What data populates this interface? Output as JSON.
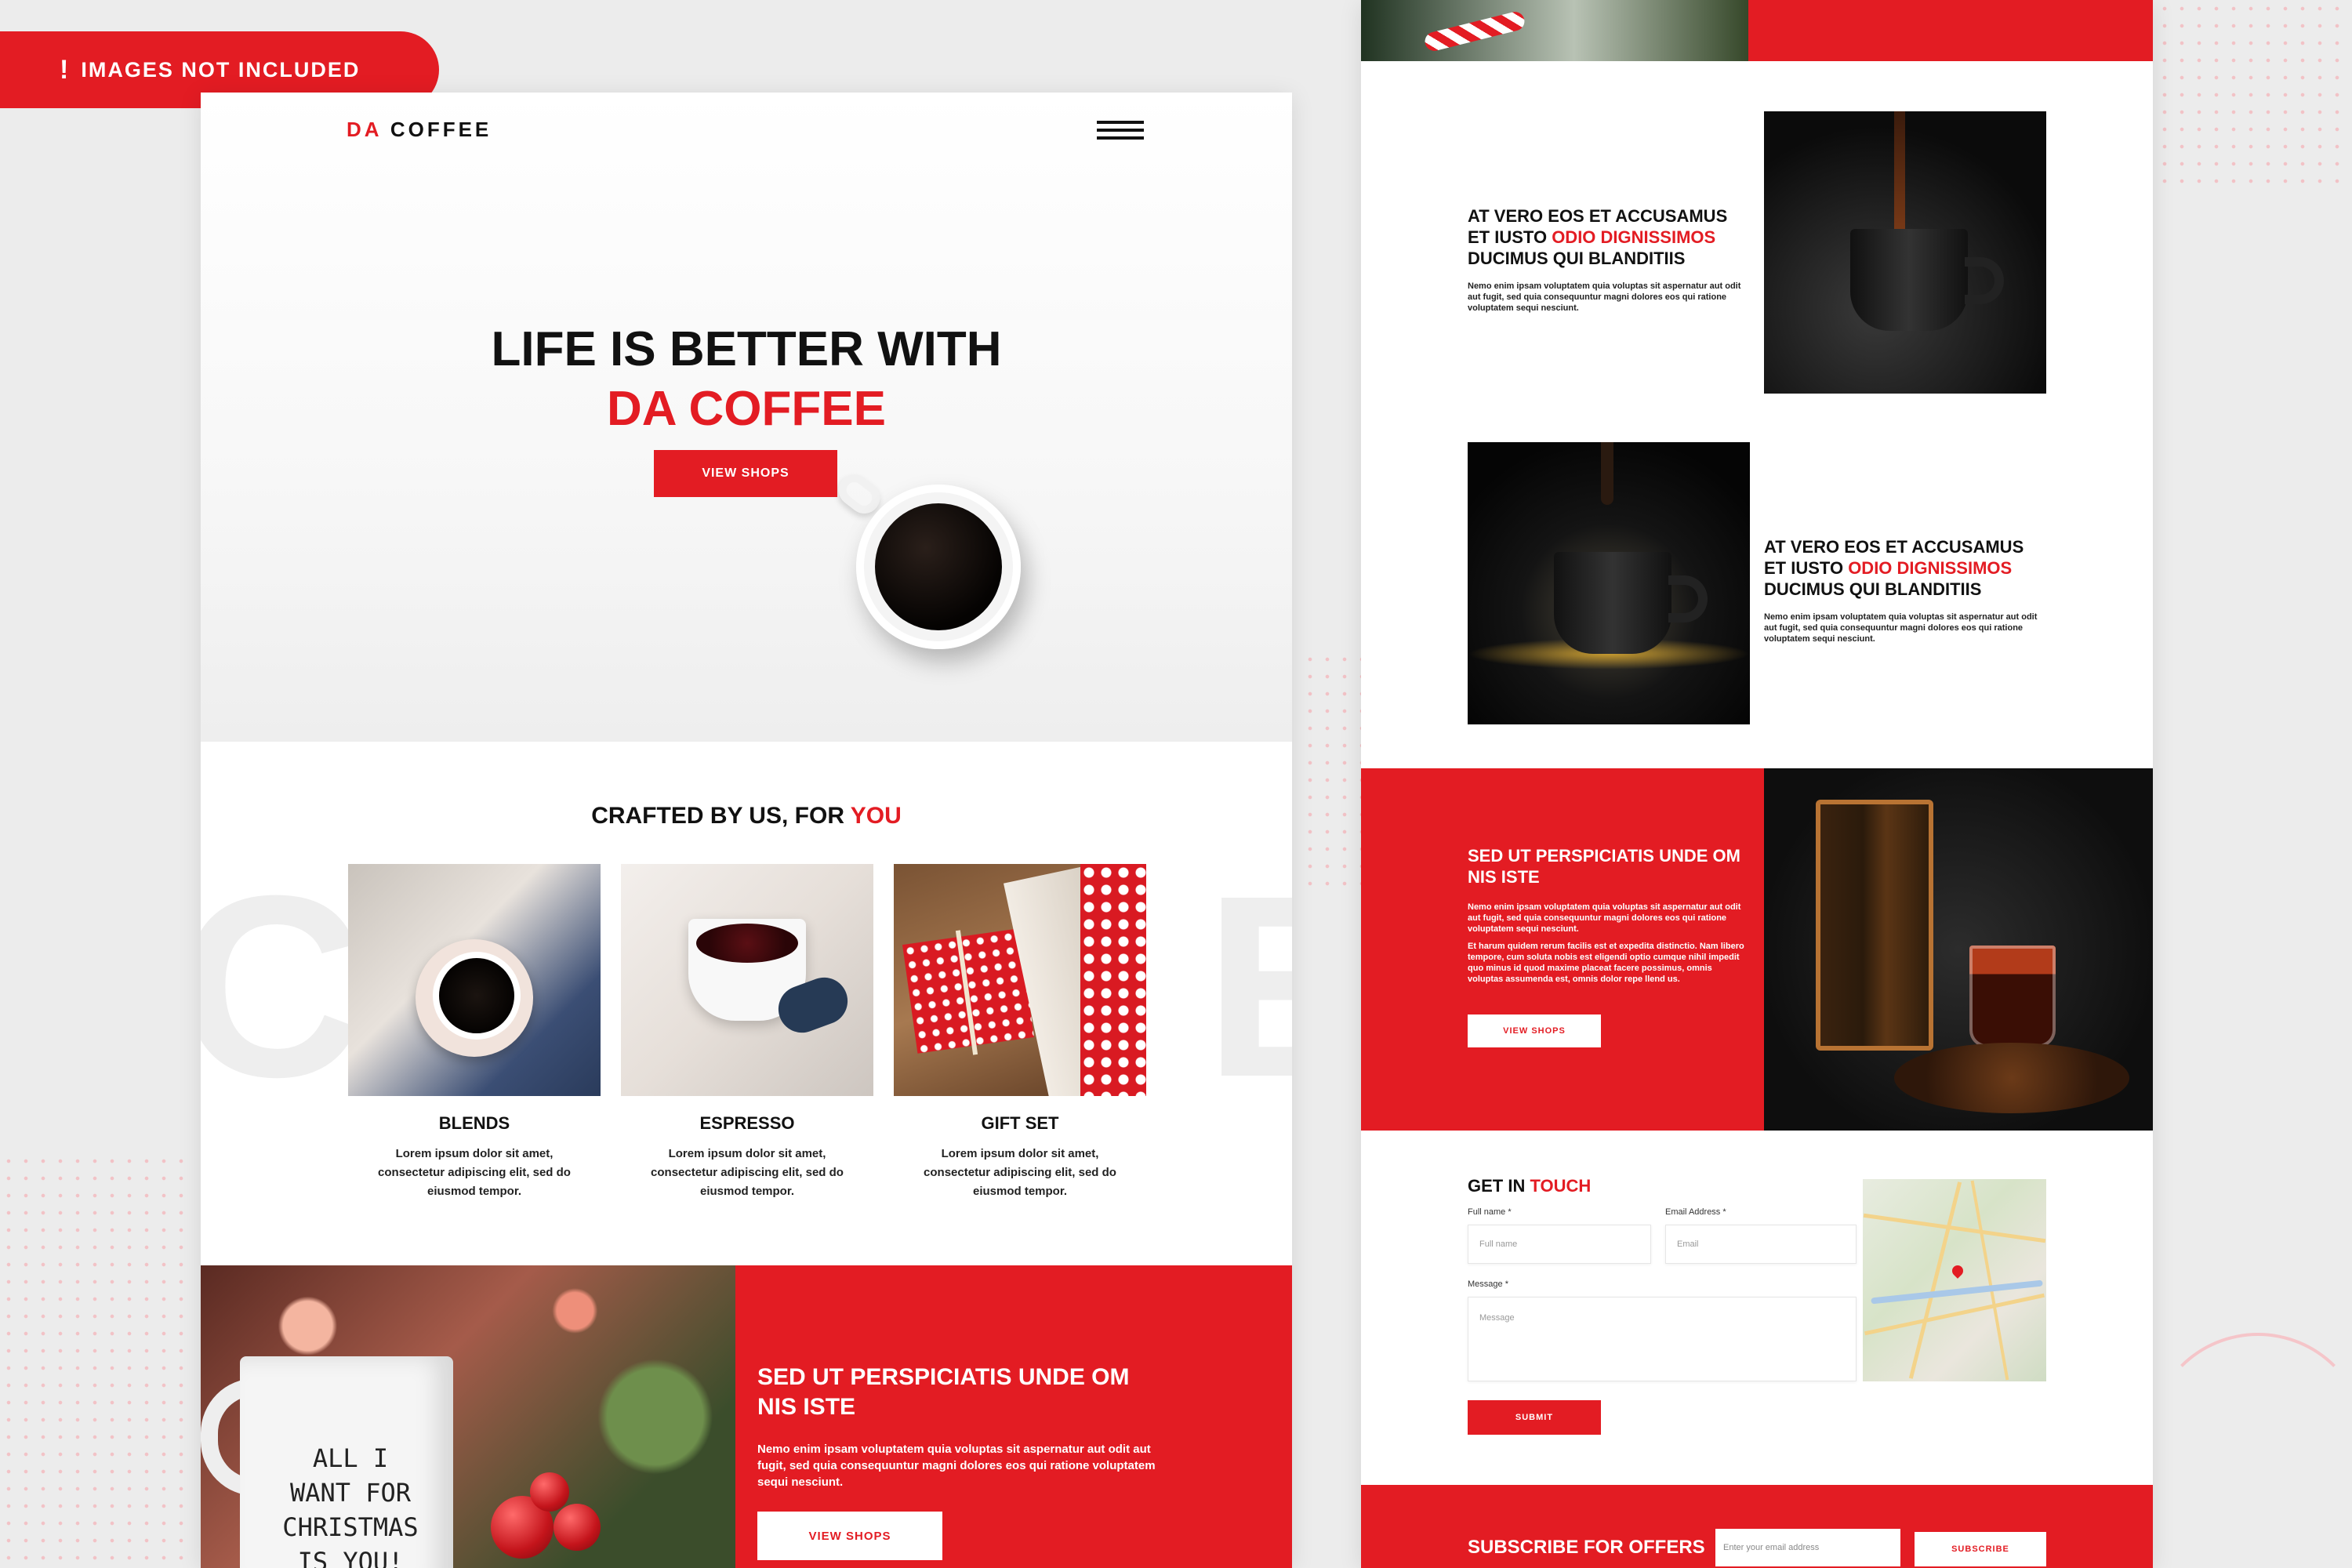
{
  "notice": {
    "label": "IMAGES NOT INCLUDED"
  },
  "brand": {
    "part1": "DA",
    "part2": "COFFEE"
  },
  "hero": {
    "line1": "LIFE IS BETTER WITH",
    "line2": "DA COFFEE",
    "button": "VIEW SHOPS"
  },
  "crafted": {
    "title_prefix": "CRAFTED BY US, FOR",
    "title_accent": "YOU",
    "background_letters": [
      "C",
      "E",
      "E"
    ],
    "cards": [
      {
        "title": "BLENDS",
        "text": "Lorem ipsum dolor sit amet, consectetur adipiscing elit, sed do eiusmod tempor."
      },
      {
        "title": "ESPRESSO",
        "text": "Lorem ipsum dolor sit amet, consectetur adipiscing elit, sed do eiusmod tempor."
      },
      {
        "title": "GIFT SET",
        "text": "Lorem ipsum dolor sit amet, consectetur adipiscing elit, sed do eiusmod tempor."
      }
    ]
  },
  "christmas": {
    "mug_text": "ALL I WANT FOR CHRISTMAS IS YOU!",
    "title": "SED UT PERSPICIATIS UNDE OM NIS ISTE",
    "body": "Nemo enim ipsam voluptatem quia voluptas sit aspernatur aut odit aut fugit, sed quia consequuntur magni dolores eos qui ratione voluptatem sequi nesciunt.",
    "button": "VIEW SHOPS"
  },
  "features": [
    {
      "title_a": "AT VERO EOS ET ACCUSAMUS ET IUSTO",
      "title_accent": "ODIO DIGNISSIMOS",
      "title_b": "DUCIMUS QUI BLANDITIIS",
      "body": "Nemo enim ipsam voluptatem quia voluptas sit aspernatur aut odit aut fugit, sed quia consequuntur magni dolores eos qui ratione voluptatem sequi nesciunt."
    },
    {
      "title_a": "AT VERO EOS ET ACCUSAMUS ET IUSTO",
      "title_accent": "ODIO DIGNISSIMOS",
      "title_b": "DUCIMUS QUI BLANDITIIS",
      "body": "Nemo enim ipsam voluptatem quia voluptas sit aspernatur aut odit aut fugit, sed quia consequuntur magni dolores eos qui ratione voluptatem sequi nesciunt."
    }
  ],
  "press": {
    "title": "SED UT PERSPICIATIS UNDE OM NIS ISTE",
    "body1": "Nemo enim ipsam voluptatem quia voluptas sit aspernatur aut odit aut fugit, sed quia consequuntur magni dolores eos qui ratione voluptatem sequi nesciunt.",
    "body2": "Et harum quidem rerum facilis est et expedita distinctio. Nam libero tempore, cum soluta nobis est eligendi optio cumque nihil impedit quo minus id quod maxime placeat facere possimus, omnis voluptas assumenda est, omnis dolor repe llend us.",
    "button": "VIEW SHOPS"
  },
  "contact": {
    "title_prefix": "GET IN",
    "title_accent": "TOUCH",
    "full_name_label": "Full name *",
    "full_name_placeholder": "Full name",
    "email_label": "Email Address *",
    "email_placeholder": "Email",
    "message_label": "Message *",
    "message_placeholder": "Message",
    "submit": "SUBMIT"
  },
  "subscribe": {
    "title": "SUBSCRIBE FOR OFFERS",
    "placeholder": "Enter your email address",
    "button": "SUBSCRIBE"
  },
  "colors": {
    "accent": "#e31c23",
    "dark": "#111111"
  }
}
